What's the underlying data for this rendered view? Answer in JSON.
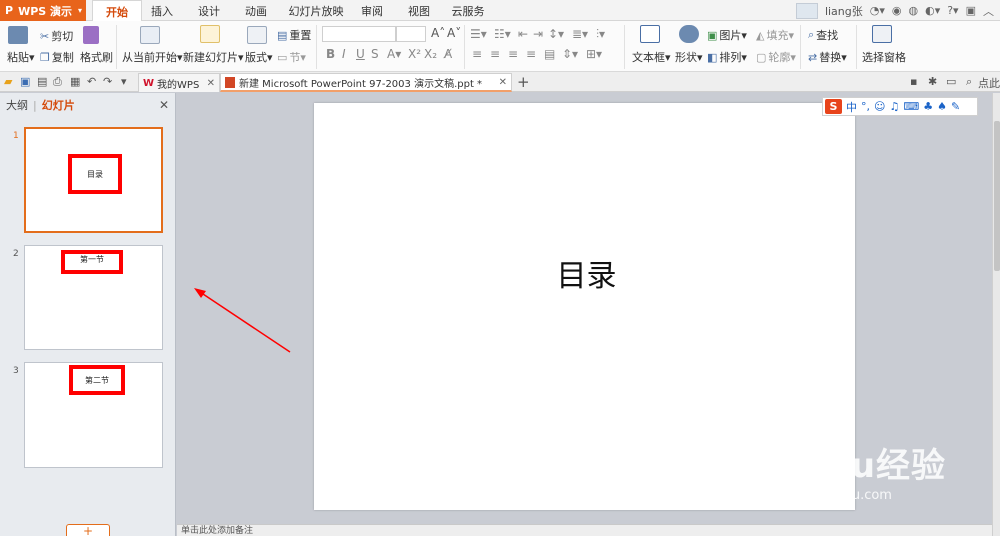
{
  "app": {
    "name": "WPS 演示",
    "logo": "P"
  },
  "menu": {
    "tabs": [
      "开始",
      "插入",
      "设计",
      "动画",
      "幻灯片放映",
      "审阅",
      "视图",
      "云服务"
    ],
    "active": "开始"
  },
  "user": {
    "name": "liang张"
  },
  "ribbon": {
    "paste": "粘贴",
    "cut": "剪切",
    "copy": "复制",
    "format_painter": "格式刷",
    "from_current": "从当前开始",
    "new_slide": "新建幻灯片",
    "layout": "版式",
    "section": "节",
    "reset": "重置",
    "text_box": "文本框",
    "shape": "形状",
    "picture": "图片",
    "fill": "填充",
    "arrange": "排列",
    "outline": "轮廓",
    "find": "查找",
    "replace": "替换",
    "select_pane": "选择窗格"
  },
  "doc_tabs": [
    {
      "label": "我的WPS"
    },
    {
      "label": "新建 Microsoft PowerPoint 97-2003 演示文稿.ppt *"
    }
  ],
  "search_label": "点此",
  "left_panel": {
    "tab_outline": "大纲",
    "tab_slides": "幻灯片",
    "slides": [
      {
        "number": "1",
        "label": "目录"
      },
      {
        "number": "2",
        "label": "第一节"
      },
      {
        "number": "3",
        "label": "第二节"
      }
    ],
    "add_button": "+"
  },
  "slide": {
    "title": "目录"
  },
  "notes_placeholder": "单击此处添加备注",
  "ime": {
    "mode": "中",
    "punct": "°,"
  },
  "watermark": {
    "main": "Baidu经验",
    "url": "jingyan.baidu.com"
  },
  "colors": {
    "accent": "#e8641b",
    "annotation": "#ff0000",
    "selected_border": "#e36d1b"
  }
}
